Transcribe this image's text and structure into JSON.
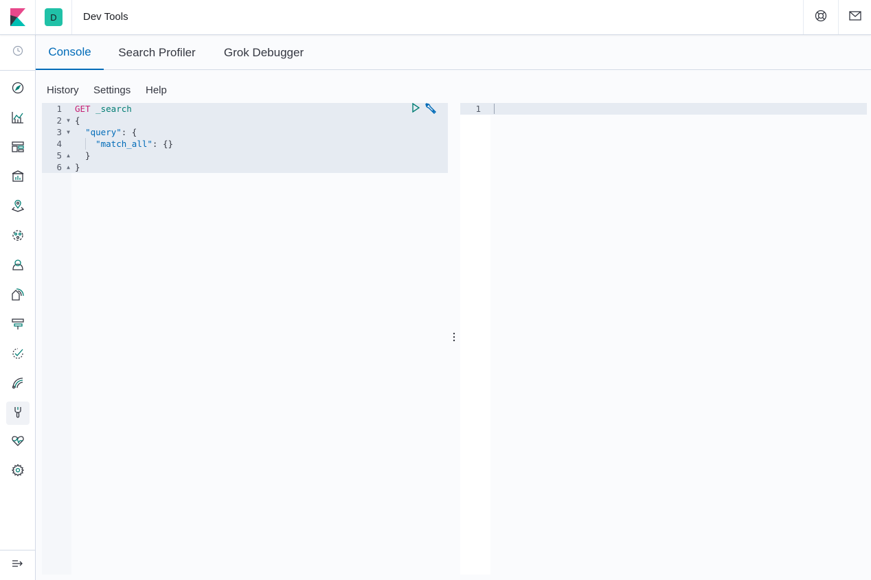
{
  "header": {
    "space_initial": "D",
    "app_title": "Dev Tools"
  },
  "sidebar": {
    "items": [
      {
        "icon": "discover-icon",
        "active": false
      },
      {
        "icon": "visualize-icon",
        "active": false
      },
      {
        "icon": "dashboard-icon",
        "active": false
      },
      {
        "icon": "canvas-icon",
        "active": false
      },
      {
        "icon": "maps-icon",
        "active": false
      },
      {
        "icon": "machine-learning-icon",
        "active": false
      },
      {
        "icon": "siem-icon",
        "active": false
      },
      {
        "icon": "logs-icon",
        "active": false
      },
      {
        "icon": "infrastructure-icon",
        "active": false
      },
      {
        "icon": "uptime-icon",
        "active": false
      },
      {
        "icon": "apm-icon",
        "active": false
      },
      {
        "icon": "dev-tools-icon",
        "active": true
      },
      {
        "icon": "monitoring-icon",
        "active": false
      },
      {
        "icon": "management-icon",
        "active": false
      }
    ]
  },
  "tabs": [
    {
      "label": "Console",
      "active": true
    },
    {
      "label": "Search Profiler",
      "active": false
    },
    {
      "label": "Grok Debugger",
      "active": false
    }
  ],
  "toolbar": {
    "history": "History",
    "settings": "Settings",
    "help": "Help"
  },
  "request_editor": {
    "line_numbers": [
      "1",
      "2",
      "3",
      "4",
      "5",
      "6"
    ],
    "lines": {
      "l1_method": "GET",
      "l1_path": "_search",
      "l2": "{",
      "l3_indent": "  ",
      "l3_key": "\"query\"",
      "l3_rest": ": {",
      "l4_indent": "    ",
      "l4_key": "\"match_all\"",
      "l4_rest": ": {}",
      "l5": "  }",
      "l6": "}"
    }
  },
  "response_editor": {
    "line_numbers": [
      "1"
    ]
  },
  "colors": {
    "accent": "#006bb8",
    "method": "#c61e73",
    "string": "#006bb8",
    "path": "#017d73",
    "space_avatar": "#20c1a7"
  }
}
